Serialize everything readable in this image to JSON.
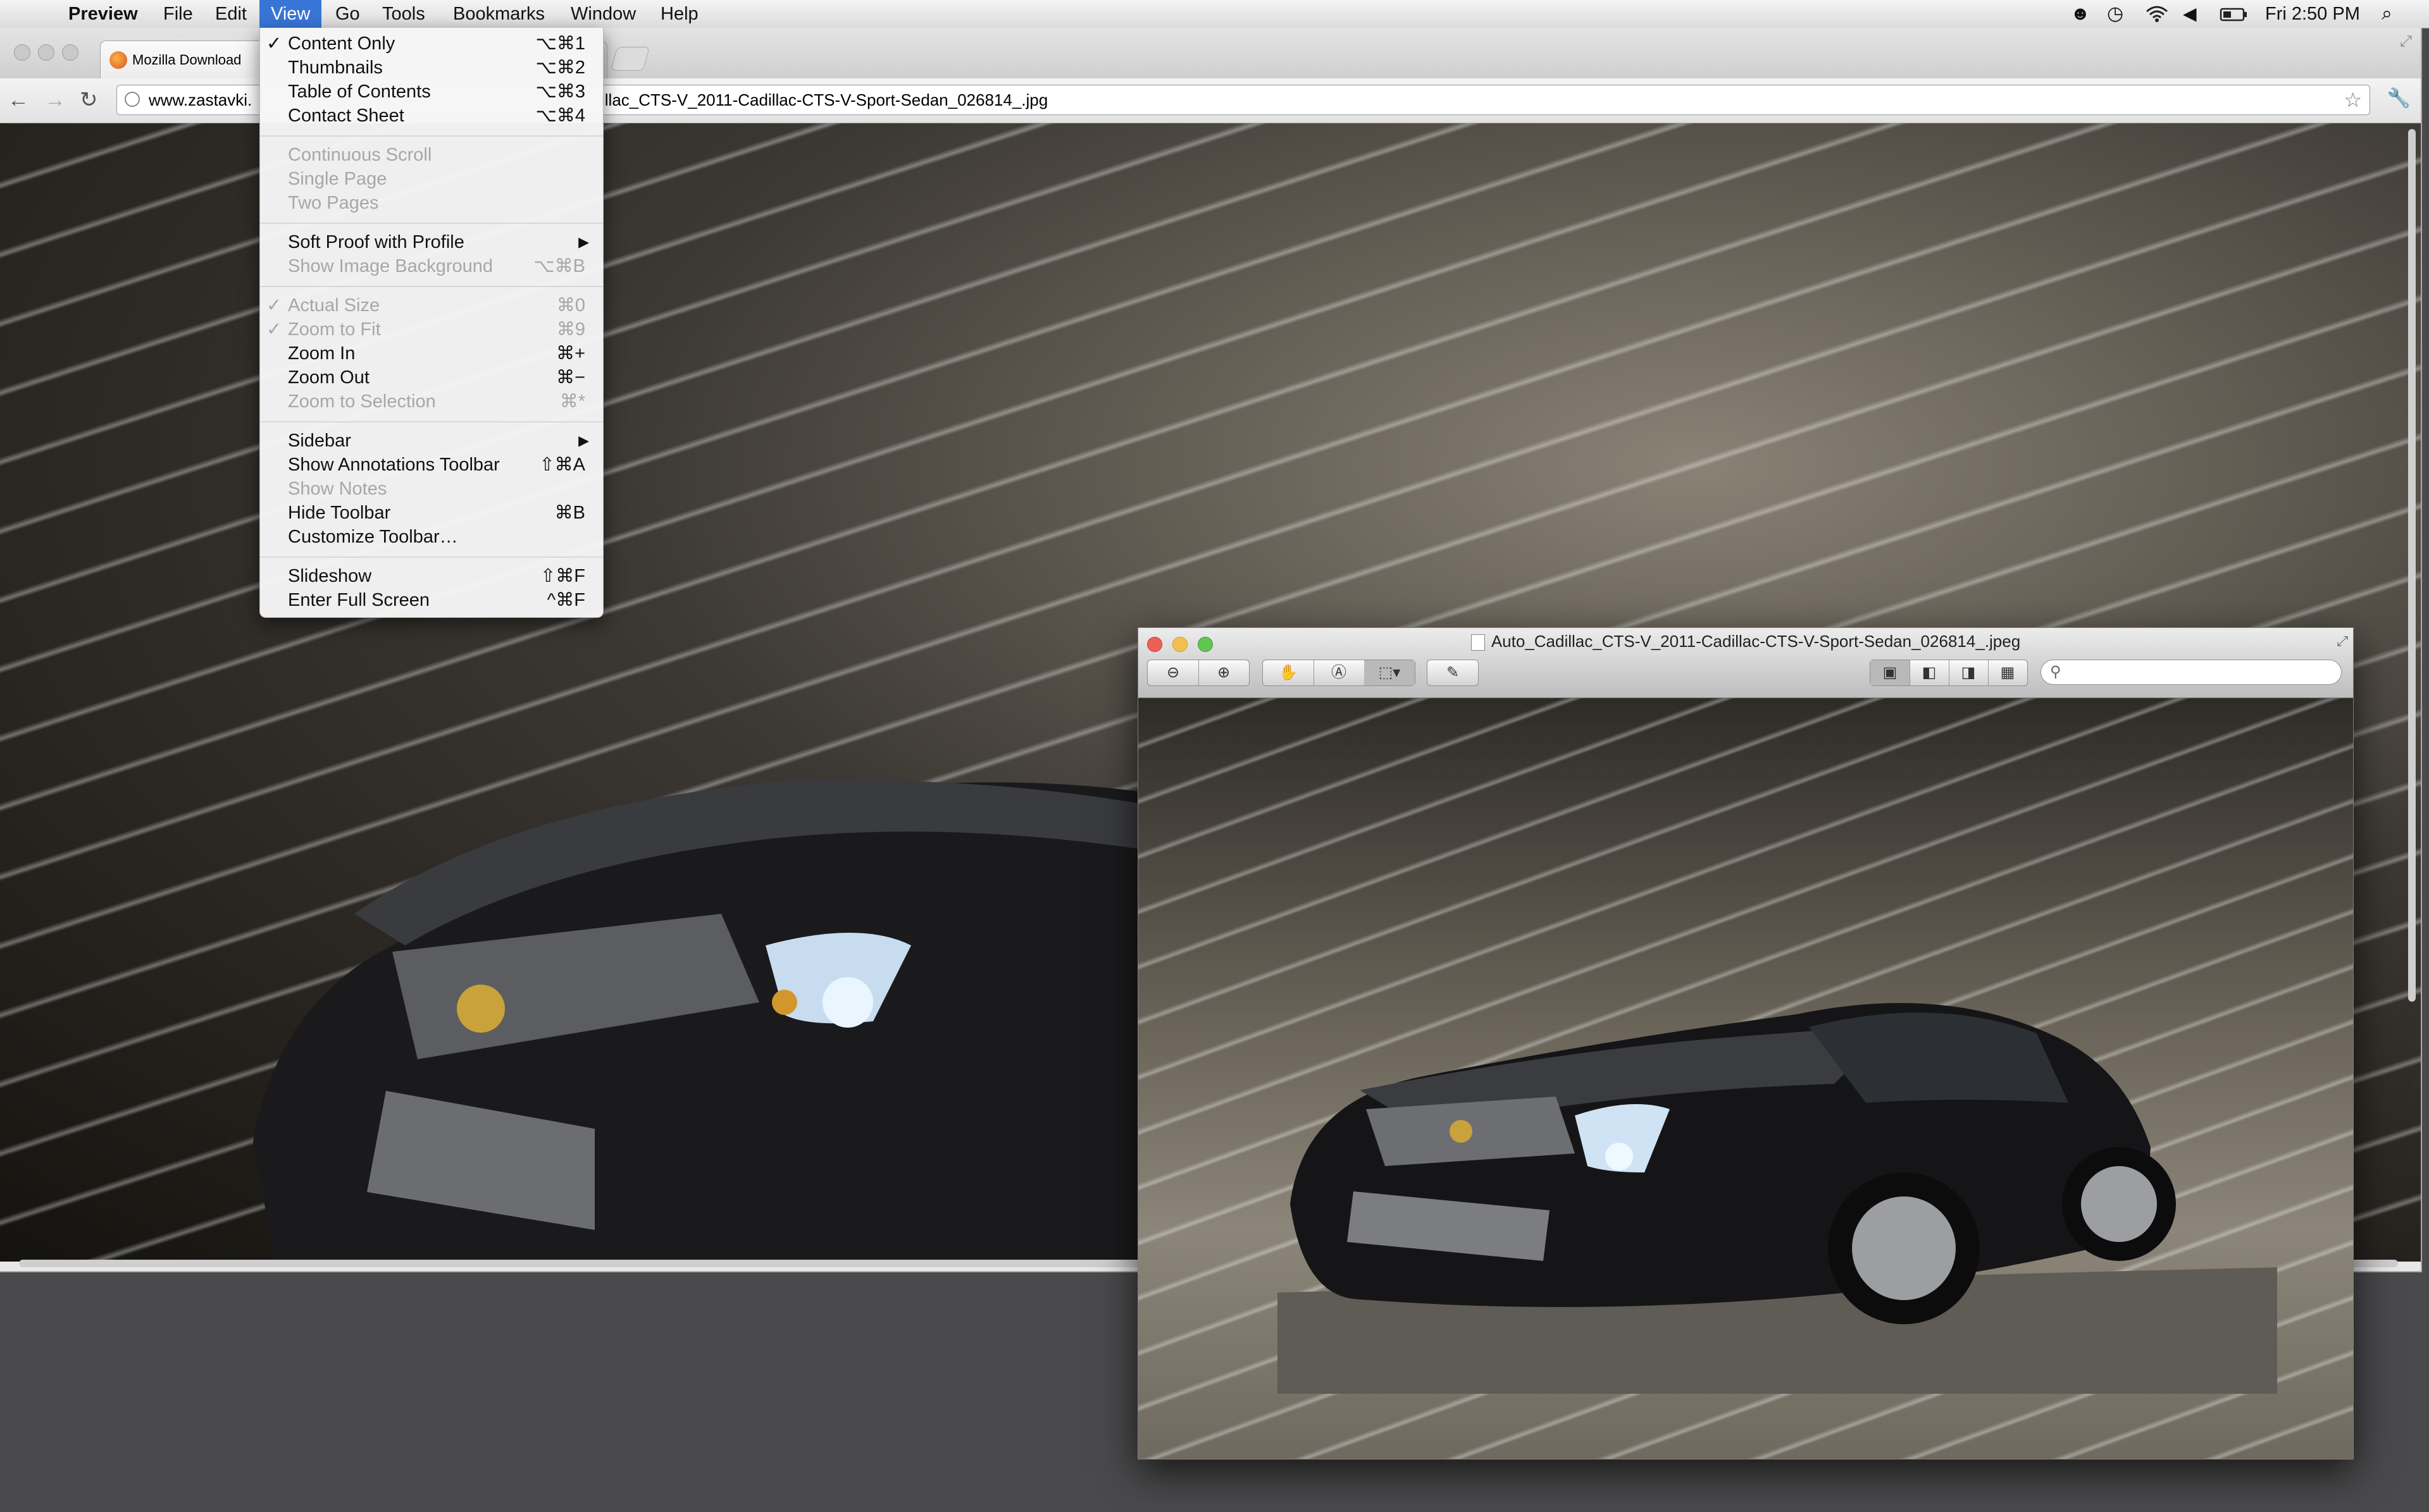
{
  "menubar": {
    "apple": "",
    "app_name": "Preview",
    "items": [
      "File",
      "Edit",
      "View",
      "Go",
      "Tools",
      "Bookmarks",
      "Window",
      "Help"
    ],
    "clock": "Fri 2:50 PM"
  },
  "browser": {
    "tabs": [
      "Mozilla Download"
    ],
    "url_visible_left": "www.zastavki.",
    "url_visible_right": "illac_CTS-V_2011-Cadillac-CTS-V-Sport-Sedan_026814_.jpg"
  },
  "view_menu": {
    "items": [
      {
        "label": "Content Only",
        "shortcut": "⌥⌘1",
        "checked": true,
        "enabled": true
      },
      {
        "label": "Thumbnails",
        "shortcut": "⌥⌘2",
        "checked": false,
        "enabled": true
      },
      {
        "label": "Table of Contents",
        "shortcut": "⌥⌘3",
        "checked": false,
        "enabled": true
      },
      {
        "label": "Contact Sheet",
        "shortcut": "⌥⌘4",
        "checked": false,
        "enabled": true
      },
      {
        "label": "Continuous Scroll",
        "shortcut": "",
        "checked": false,
        "enabled": false
      },
      {
        "label": "Single Page",
        "shortcut": "",
        "checked": false,
        "enabled": false
      },
      {
        "label": "Two Pages",
        "shortcut": "",
        "checked": false,
        "enabled": false
      },
      {
        "label": "Soft Proof with Profile",
        "shortcut": "",
        "submenu": true,
        "enabled": true
      },
      {
        "label": "Show Image Background",
        "shortcut": "⌥⌘B",
        "checked": false,
        "enabled": false
      },
      {
        "label": "Actual Size",
        "shortcut": "⌘0",
        "checked": true,
        "enabled": false
      },
      {
        "label": "Zoom to Fit",
        "shortcut": "⌘9",
        "checked": true,
        "enabled": false
      },
      {
        "label": "Zoom In",
        "shortcut": "⌘+",
        "checked": false,
        "enabled": true
      },
      {
        "label": "Zoom Out",
        "shortcut": "⌘−",
        "checked": false,
        "enabled": true
      },
      {
        "label": "Zoom to Selection",
        "shortcut": "⌘*",
        "checked": false,
        "enabled": false
      },
      {
        "label": "Sidebar",
        "shortcut": "",
        "submenu": true,
        "enabled": true
      },
      {
        "label": "Show Annotations Toolbar",
        "shortcut": "⇧⌘A",
        "checked": false,
        "enabled": true
      },
      {
        "label": "Show Notes",
        "shortcut": "",
        "checked": false,
        "enabled": false
      },
      {
        "label": "Hide Toolbar",
        "shortcut": "⌘B",
        "checked": false,
        "enabled": true
      },
      {
        "label": "Customize Toolbar…",
        "shortcut": "",
        "checked": false,
        "enabled": true
      },
      {
        "label": "Slideshow",
        "shortcut": "⇧⌘F",
        "checked": false,
        "enabled": true
      },
      {
        "label": "Enter Full Screen",
        "shortcut": "^⌘F",
        "checked": false,
        "enabled": true
      }
    ]
  },
  "preview_window": {
    "title": "Auto_Cadillac_CTS-V_2011-Cadillac-CTS-V-Sport-Sedan_026814_.jpeg",
    "toolbar_icons": [
      "zoom-out-icon",
      "zoom-in-icon",
      "hand-icon",
      "text-select-icon",
      "rect-select-icon",
      "pencil-icon",
      "view-content-only-icon",
      "view-thumbnails-icon",
      "view-toc-icon",
      "view-contact-sheet-icon"
    ],
    "search_placeholder": ""
  },
  "colors": {
    "menu_highlight": "#3875d7",
    "close": "#ec5f57",
    "minimize": "#f5bf4f",
    "zoom": "#61c554"
  }
}
